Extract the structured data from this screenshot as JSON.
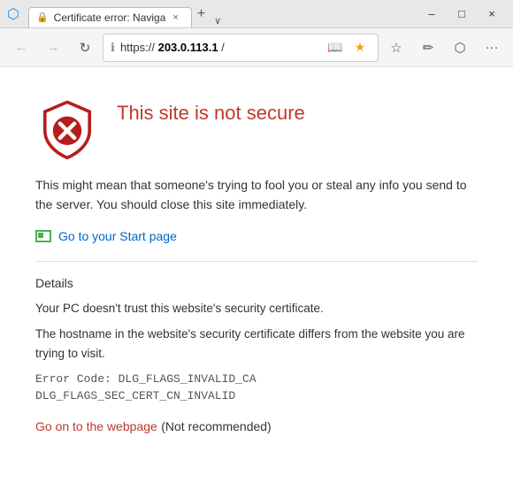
{
  "titlebar": {
    "tab_title": "Certificate error: Naviga",
    "tab_favicon": "⚠",
    "close_label": "×",
    "minimize_label": "–",
    "maximize_label": "□",
    "new_tab_label": "+",
    "tab_dropdown_label": "∨"
  },
  "navbar": {
    "back_label": "←",
    "forward_label": "→",
    "refresh_label": "↻",
    "security_icon": "ℹ",
    "url_prefix": "https://",
    "url_host": "203.0.113.1",
    "url_suffix": " /",
    "reading_view_label": "📖",
    "favorites_label": "☆",
    "star_label": "★",
    "share_label": "↗",
    "more_label": "···"
  },
  "page": {
    "error_title": "This site is not secure",
    "error_description": "This might mean that someone's trying to fool you or steal any info you send to the server. You should close this site immediately.",
    "start_page_label": "Go to your Start page",
    "details_label": "Details",
    "details_text1": "Your PC doesn't trust this website's security certificate.",
    "details_text2": "The hostname in the website's security certificate differs from the website you are trying to visit.",
    "error_code_line1": "Error Code:  DLG_FLAGS_INVALID_CA",
    "error_code_line2": "DLG_FLAGS_SEC_CERT_CN_INVALID",
    "go_on_label": "Go on to the webpage",
    "not_recommended_label": "(Not recommended)"
  }
}
